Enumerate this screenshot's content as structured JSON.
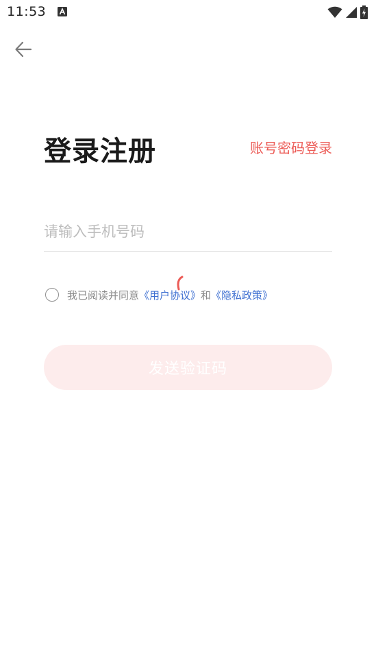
{
  "status_bar": {
    "time": "11:53",
    "icons": [
      "a-notification-icon",
      "wifi-icon",
      "signal-icon",
      "battery-charging-icon"
    ]
  },
  "header": {
    "back_icon": "arrow-left-icon",
    "title": "登录注册",
    "password_login_label": "账号密码登录"
  },
  "form": {
    "phone_placeholder": "请输入手机号码",
    "phone_value": "",
    "agreement": {
      "checked": false,
      "prefix": "我已阅读并同意",
      "user_agreement": "《用户协议》",
      "conjunction": "和",
      "privacy_policy": "《隐私政策》"
    },
    "send_code_label": "发送验证码"
  },
  "colors": {
    "accent": "#ec5b56",
    "link": "#3d6fd1",
    "button_disabled_bg": "#fdecec"
  }
}
